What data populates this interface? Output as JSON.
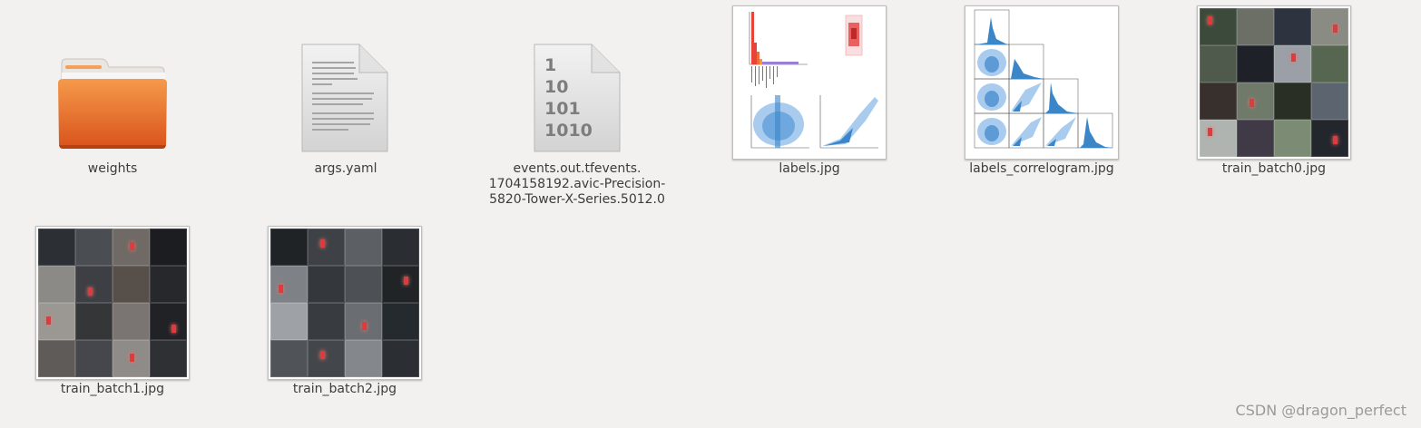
{
  "files": [
    {
      "name": "weights",
      "icon": "folder-icon"
    },
    {
      "name": "args.yaml",
      "icon": "text-file-icon"
    },
    {
      "name": "events.out.tfevents.\n1704158192.avic-Precision-\n5820-Tower-X-Series.5012.0",
      "icon": "binary-file-icon",
      "binary_text": [
        "1",
        "10",
        "101",
        "1010"
      ]
    },
    {
      "name": "labels.jpg",
      "icon": "image-thumbnail-icon"
    },
    {
      "name": "labels_correlogram.jpg",
      "icon": "image-thumbnail-icon"
    },
    {
      "name": "train_batch0.jpg",
      "icon": "image-thumbnail-icon"
    },
    {
      "name": "train_batch1.jpg",
      "icon": "image-thumbnail-icon"
    },
    {
      "name": "train_batch2.jpg",
      "icon": "image-thumbnail-icon"
    }
  ],
  "watermark": "CSDN @dragon_perfect",
  "colors": {
    "background": "#f2f1f0",
    "folder": "#e2682a",
    "folder_tab": "#f2a05a",
    "text": "#3c3c3c",
    "histogram_blue": "#3a86c8"
  }
}
